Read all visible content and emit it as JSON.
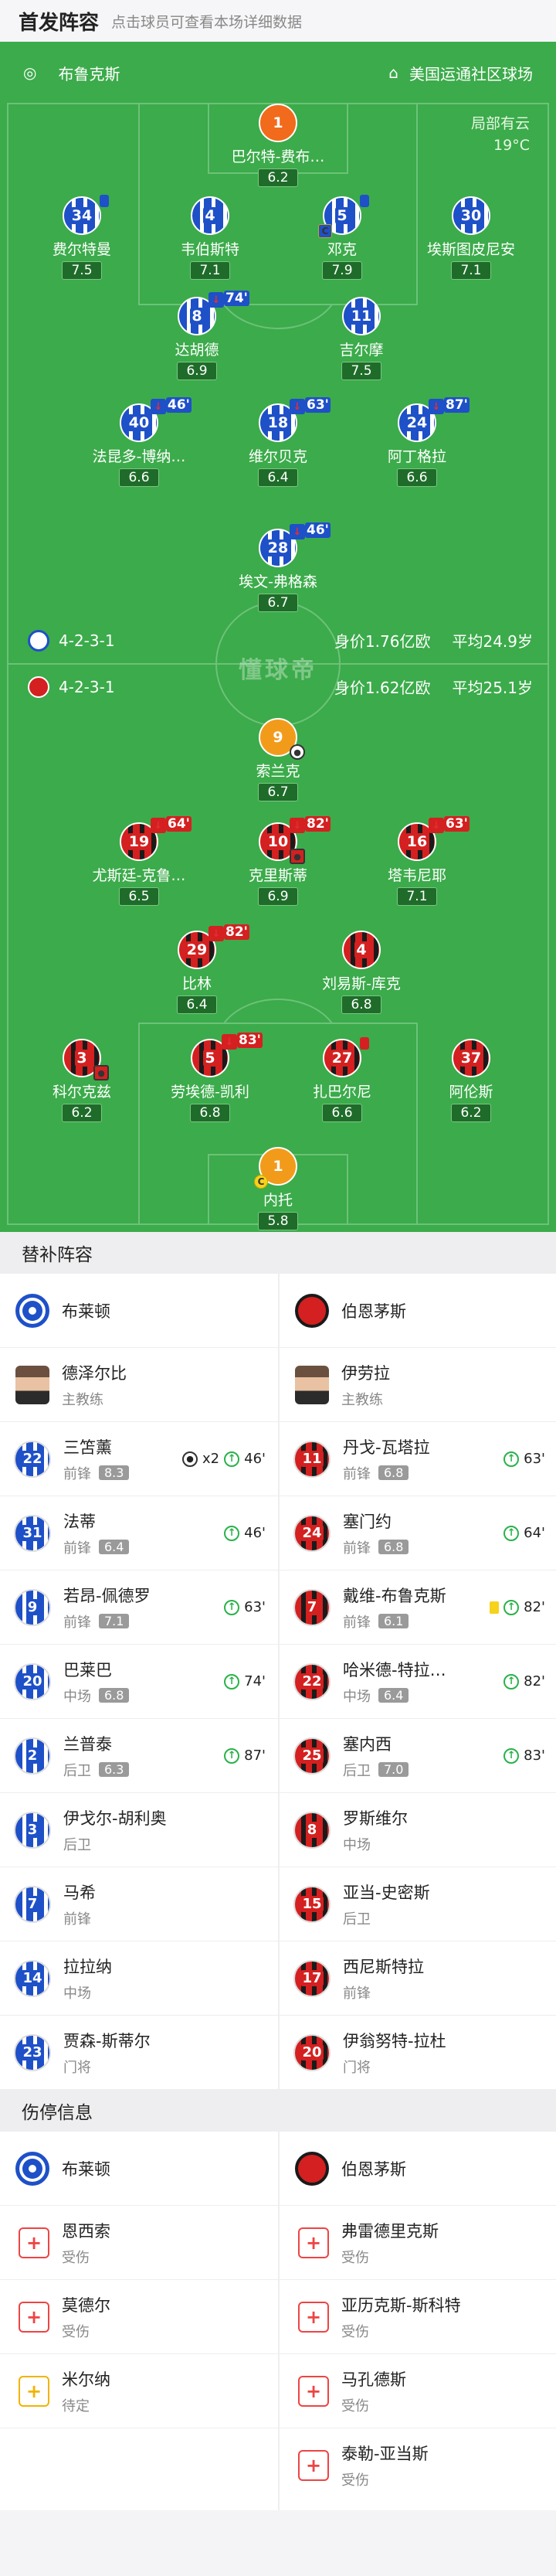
{
  "header": {
    "title": "首发阵容",
    "subtitle": "点击球员可查看本场详细数据"
  },
  "match": {
    "home": "布鲁克斯",
    "venue": "美国运通社区球场",
    "weather": "局部有云",
    "temp": "19°C",
    "watermark": "懂球帝"
  },
  "home_info": {
    "formation": "4-2-3-1",
    "value": "身价1.76亿欧",
    "age": "平均24.9岁"
  },
  "away_info": {
    "formation": "4-2-3-1",
    "value": "身价1.62亿欧",
    "age": "平均25.1岁"
  },
  "home_players": [
    {
      "num": "1",
      "name": "巴尔特-费布…",
      "rating": "6.2"
    },
    {
      "num": "34",
      "name": "费尔特曼",
      "rating": "7.5"
    },
    {
      "num": "4",
      "name": "韦伯斯特",
      "rating": "7.1"
    },
    {
      "num": "5",
      "name": "邓克",
      "rating": "7.9"
    },
    {
      "num": "30",
      "name": "埃斯图皮尼安",
      "rating": "7.1"
    },
    {
      "num": "8",
      "name": "达胡德",
      "rating": "6.9",
      "sub_min": "74'"
    },
    {
      "num": "11",
      "name": "吉尔摩",
      "rating": "7.5"
    },
    {
      "num": "40",
      "name": "法昆多-博纳…",
      "rating": "6.6",
      "sub_min": "46'"
    },
    {
      "num": "18",
      "name": "维尔贝克",
      "rating": "6.4",
      "sub_min": "63'"
    },
    {
      "num": "24",
      "name": "阿丁格拉",
      "rating": "6.6",
      "sub_min": "87'"
    },
    {
      "num": "28",
      "name": "埃文-弗格森",
      "rating": "6.7",
      "sub_min": "46'"
    }
  ],
  "away_players": [
    {
      "num": "9",
      "name": "索兰克",
      "rating": "6.7"
    },
    {
      "num": "19",
      "name": "尤斯廷-克鲁…",
      "rating": "6.5",
      "sub_min": "64'"
    },
    {
      "num": "10",
      "name": "克里斯蒂",
      "rating": "6.9",
      "sub_min": "82'"
    },
    {
      "num": "16",
      "name": "塔韦尼耶",
      "rating": "7.1",
      "sub_min": "63'"
    },
    {
      "num": "29",
      "name": "比林",
      "rating": "6.4",
      "sub_min": "82'"
    },
    {
      "num": "4",
      "name": "刘易斯-库克",
      "rating": "6.8"
    },
    {
      "num": "3",
      "name": "科尔克兹",
      "rating": "6.2"
    },
    {
      "num": "5",
      "name": "劳埃德-凯利",
      "rating": "6.8",
      "sub_min": "83'"
    },
    {
      "num": "27",
      "name": "扎巴尔尼",
      "rating": "6.6"
    },
    {
      "num": "37",
      "name": "阿伦斯",
      "rating": "6.2"
    },
    {
      "num": "1",
      "name": "内托",
      "rating": "5.8"
    }
  ],
  "subs": {
    "title": "替补阵容",
    "home_team": "布莱顿",
    "away_team": "伯恩茅斯",
    "home_coach": {
      "name": "德泽尔比",
      "role": "主教练"
    },
    "away_coach": {
      "name": "伊劳拉",
      "role": "主教练"
    },
    "home": [
      {
        "num": "22",
        "name": "三笘薰",
        "pos": "前锋",
        "rating": "8.3",
        "goals": "x2",
        "min": "46'"
      },
      {
        "num": "31",
        "name": "法蒂",
        "pos": "前锋",
        "rating": "6.4",
        "min": "46'"
      },
      {
        "num": "9",
        "name": "若昂-佩德罗",
        "pos": "前锋",
        "rating": "7.1",
        "min": "63'"
      },
      {
        "num": "20",
        "name": "巴莱巴",
        "pos": "中场",
        "rating": "6.8",
        "min": "74'"
      },
      {
        "num": "2",
        "name": "兰普泰",
        "pos": "后卫",
        "rating": "6.3",
        "min": "87'"
      },
      {
        "num": "3",
        "name": "伊戈尔-胡利奥",
        "pos": "后卫"
      },
      {
        "num": "7",
        "name": "马希",
        "pos": "前锋"
      },
      {
        "num": "14",
        "name": "拉拉纳",
        "pos": "中场"
      },
      {
        "num": "23",
        "name": "贾森-斯蒂尔",
        "pos": "门将"
      }
    ],
    "away": [
      {
        "num": "11",
        "name": "丹戈-瓦塔拉",
        "pos": "前锋",
        "rating": "6.8",
        "min": "63'"
      },
      {
        "num": "24",
        "name": "塞门约",
        "pos": "前锋",
        "rating": "6.8",
        "min": "64'"
      },
      {
        "num": "7",
        "name": "戴维-布鲁克斯",
        "pos": "前锋",
        "rating": "6.1",
        "min": "82'",
        "card": true
      },
      {
        "num": "22",
        "name": "哈米德-特拉…",
        "pos": "中场",
        "rating": "6.4",
        "min": "82'"
      },
      {
        "num": "25",
        "name": "塞内西",
        "pos": "后卫",
        "rating": "7.0",
        "min": "83'"
      },
      {
        "num": "8",
        "name": "罗斯维尔",
        "pos": "中场"
      },
      {
        "num": "15",
        "name": "亚当-史密斯",
        "pos": "后卫"
      },
      {
        "num": "17",
        "name": "西尼斯特拉",
        "pos": "前锋"
      },
      {
        "num": "20",
        "name": "伊翁努特-拉杜",
        "pos": "门将"
      }
    ]
  },
  "injuries": {
    "title": "伤停信息",
    "home_team": "布莱顿",
    "away_team": "伯恩茅斯",
    "home": [
      {
        "name": "恩西索",
        "status": "受伤"
      },
      {
        "name": "莫德尔",
        "status": "受伤"
      },
      {
        "name": "米尔纳",
        "status": "待定"
      }
    ],
    "away": [
      {
        "name": "弗雷德里克斯",
        "status": "受伤"
      },
      {
        "name": "亚历克斯-斯科特",
        "status": "受伤"
      },
      {
        "name": "马孔德斯",
        "status": "受伤"
      },
      {
        "name": "泰勒-亚当斯",
        "status": "受伤"
      }
    ]
  },
  "colors": {
    "pitch": "#3cab4b",
    "home": "#1e50c8",
    "away": "#d42020"
  }
}
